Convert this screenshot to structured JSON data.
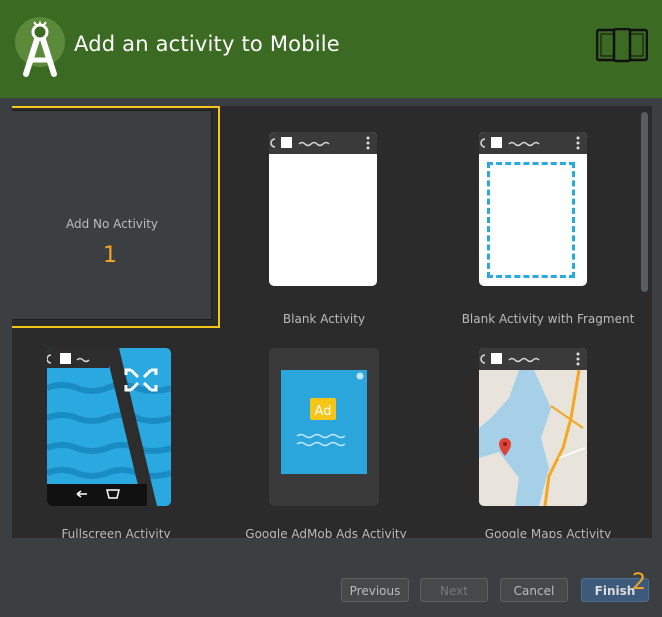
{
  "header": {
    "title": "Add an activity to Mobile",
    "logo_icon": "android-studio-logo-icon",
    "device_icon": "phone-tablet-icon",
    "background": "#3b6b22"
  },
  "templates": [
    {
      "label": "Add No Activity",
      "selected": true
    },
    {
      "label": "Blank Activity"
    },
    {
      "label": "Blank Activity with Fragment"
    },
    {
      "label": "Fullscreen Activity"
    },
    {
      "label": "Google AdMob Ads Activity",
      "ad_text": "Ad"
    },
    {
      "label": "Google Maps Activity"
    }
  ],
  "annotations": {
    "first": "1",
    "second": "2"
  },
  "buttons": {
    "previous": "Previous",
    "next": "Next",
    "cancel": "Cancel",
    "finish": "Finish"
  },
  "colors": {
    "selection_border": "#f5c518",
    "annotation": "#f5a623",
    "fullscreen_blue": "#29a9e0",
    "ad_blue": "#2aa6dc",
    "ad_badge": "#f5c518"
  }
}
